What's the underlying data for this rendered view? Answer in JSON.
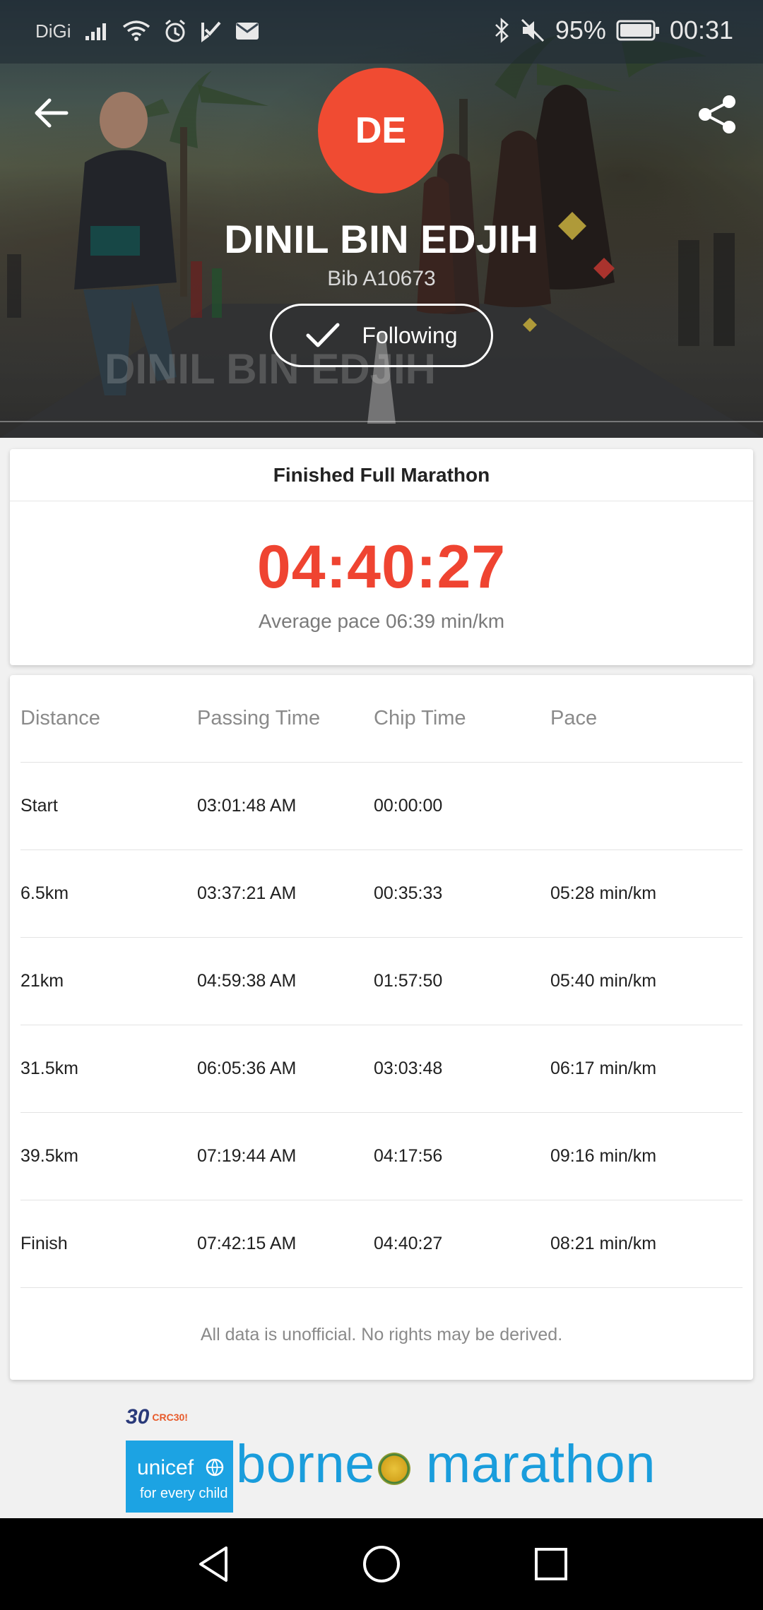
{
  "status_bar": {
    "carrier": "DiGi",
    "battery": "95%",
    "time": "00:31"
  },
  "header": {
    "avatar_initials": "DE",
    "runner_name": "DINIL BIN EDJIH",
    "bib": "Bib A10673",
    "follow_label": "Following",
    "ghost_name": "DINIL BIN EDJIH"
  },
  "summary": {
    "title": "Finished Full Marathon",
    "finish_time": "04:40:27",
    "average_pace": "Average pace 06:39 min/km"
  },
  "splits": {
    "headers": [
      "Distance",
      "Passing Time",
      "Chip Time",
      "Pace"
    ],
    "rows": [
      [
        "Start",
        "03:01:48 AM",
        "00:00:00",
        ""
      ],
      [
        "6.5km",
        "03:37:21 AM",
        "00:35:33",
        "05:28 min/km"
      ],
      [
        "21km",
        "04:59:38 AM",
        "01:57:50",
        "05:40 min/km"
      ],
      [
        "31.5km",
        "06:05:36 AM",
        "03:03:48",
        "06:17 min/km"
      ],
      [
        "39.5km",
        "07:19:44 AM",
        "04:17:56",
        "09:16 min/km"
      ],
      [
        "Finish",
        "07:42:15 AM",
        "04:40:27",
        "08:21 min/km"
      ]
    ],
    "disclaimer": "All data is unofficial. No rights may be derived."
  },
  "sponsors": {
    "crc_number": "30",
    "crc_label": "CRC30!",
    "unicef_word": "unicef",
    "unicef_tagline": "for every child",
    "event_word_1": "borne",
    "event_word_2": "marathon"
  },
  "colors": {
    "accent": "#ef4431",
    "avatar_bg": "#f04b32",
    "event_blue": "#1a9ddc"
  }
}
